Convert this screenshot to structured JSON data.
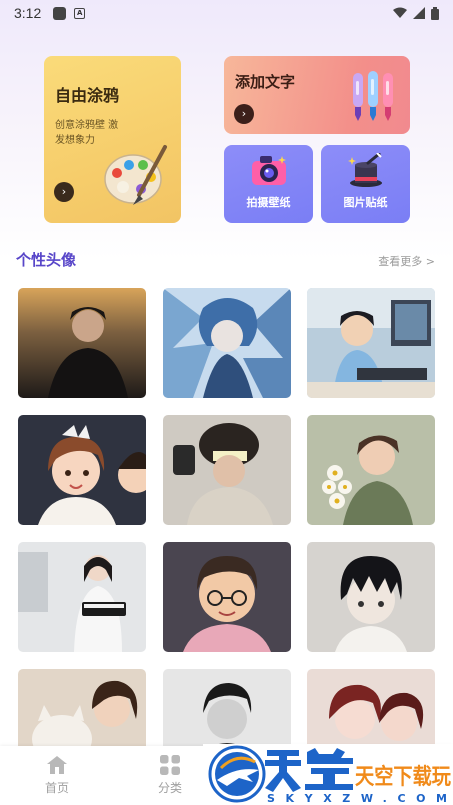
{
  "status_bar": {
    "time": "3:12"
  },
  "cards": {
    "doodle": {
      "title": "自由涂鸦",
      "subtitle": "创意涂鸦壁 激发想象力",
      "arrow": "›"
    },
    "text": {
      "title": "添加文字",
      "arrow": "›"
    },
    "photo_wallpaper": {
      "label": "拍摄壁纸"
    },
    "sticker": {
      "label": "图片贴纸"
    }
  },
  "section": {
    "title": "个性头像",
    "more": "查看更多 >"
  },
  "avatars": [
    "boy-night-portrait",
    "blue-anime-boy",
    "anime-boy-computer",
    "cartoon-couple",
    "boy-fur-hat",
    "boy-with-flowers",
    "girl-with-keyboard",
    "cartoon-glasses-boy",
    "anime-black-hair-boy",
    "girl-with-cat",
    "bw-boy",
    "red-hair-anime"
  ],
  "bottom_nav": [
    {
      "label": "首页",
      "icon": "home-icon"
    },
    {
      "label": "分类",
      "icon": "grid-icon"
    }
  ],
  "watermark": {
    "main": "天空下载玩",
    "sub": "SKYXZW.COM"
  },
  "colors": {
    "accent": "#5846c9",
    "doodle_card": "#f6cd6b",
    "text_card": "#f38f8a",
    "small_card": "#7f82f6"
  }
}
